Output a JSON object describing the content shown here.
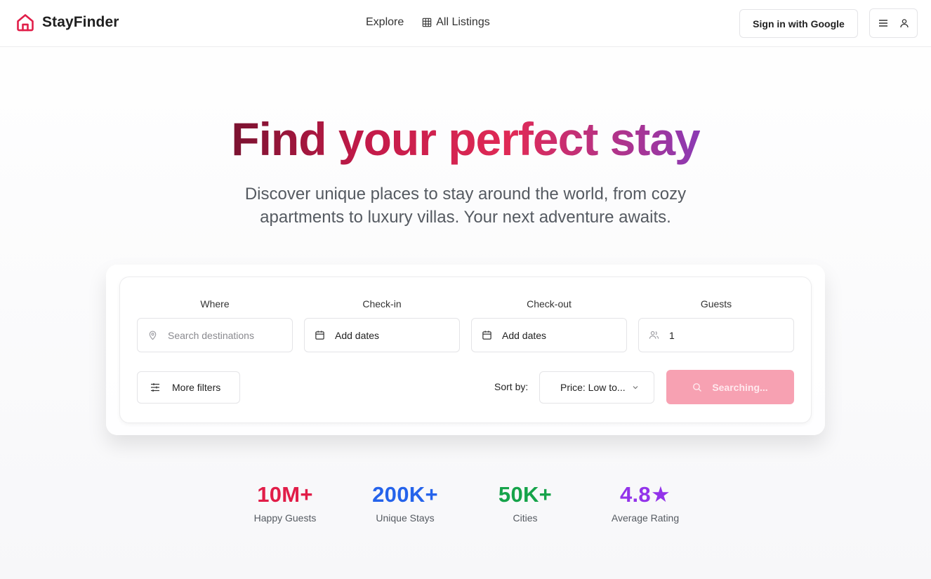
{
  "header": {
    "brand": "StayFinder",
    "nav": {
      "explore": "Explore",
      "all_listings": "All Listings"
    },
    "signin_label": "Sign in with Google"
  },
  "hero": {
    "title": "Find your perfect stay",
    "subtitle": "Discover unique places to stay around the world, from cozy apartments to luxury villas. Your next adventure awaits."
  },
  "search": {
    "where": {
      "label": "Where",
      "placeholder": "Search destinations",
      "value": ""
    },
    "checkin": {
      "label": "Check-in",
      "value": "Add dates"
    },
    "checkout": {
      "label": "Check-out",
      "value": "Add dates"
    },
    "guests": {
      "label": "Guests",
      "value": "1"
    },
    "more_filters": "More filters",
    "sort_label": "Sort by:",
    "sort_value": "Price: Low to...",
    "search_button": "Searching..."
  },
  "stats": [
    {
      "value": "10M+",
      "label": "Happy Guests",
      "color": "#e11d48"
    },
    {
      "value": "200K+",
      "label": "Unique Stays",
      "color": "#2563eb"
    },
    {
      "value": "50K+",
      "label": "Cities",
      "color": "#16a34a"
    },
    {
      "value": "4.8★",
      "label": "Average Rating",
      "color": "#9333ea"
    }
  ],
  "colors": {
    "brand": "#e11d48",
    "search_button_bg": "#f7a1b2"
  },
  "icons": {
    "logo": "home-icon",
    "all_listings": "grid-icon",
    "where": "map-pin-icon",
    "checkin": "calendar-icon",
    "checkout": "calendar-icon",
    "guests": "users-icon",
    "filters": "sliders-icon",
    "sort": "chevron-down-icon",
    "search": "search-icon",
    "menu": "menu-icon",
    "user": "user-icon"
  }
}
